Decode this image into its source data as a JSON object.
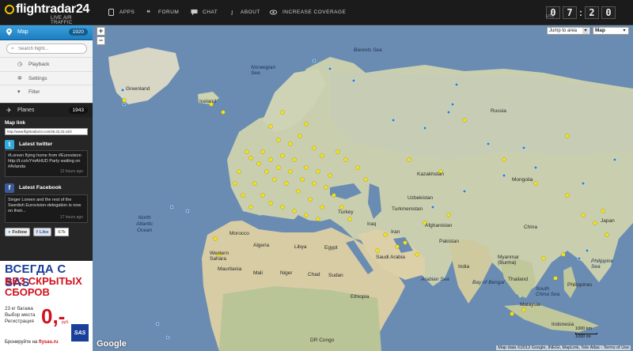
{
  "app": {
    "logo": "flightradar24",
    "tagline": "LIVE AIR TRAFFIC"
  },
  "nav": {
    "items": [
      {
        "label": "APPS",
        "icon": "apps-icon"
      },
      {
        "label": "FORUM",
        "icon": "forum-icon"
      },
      {
        "label": "CHAT",
        "icon": "chat-icon"
      },
      {
        "label": "ABOUT",
        "icon": "info-icon"
      },
      {
        "label": "INCREASE COVERAGE",
        "icon": "eye-icon"
      }
    ]
  },
  "clock": {
    "digits": [
      "0",
      "7",
      "2",
      "0"
    ],
    "separator": ":",
    "zone": "UTC"
  },
  "sidebar": {
    "map": {
      "label": "Map",
      "count": "1920"
    },
    "search": {
      "placeholder": "Search flight..."
    },
    "submenu": [
      {
        "label": "Playback",
        "icon": "clock-icon"
      },
      {
        "label": "Settings",
        "icon": "gear-icon"
      },
      {
        "label": "Filter",
        "icon": "filter-icon"
      }
    ],
    "planes": {
      "label": "Planes",
      "count": "1943"
    },
    "map_link": {
      "label": "Map link",
      "url": "http://www.flightradar24.com/48.32,23.44/3"
    },
    "twitter": {
      "title": "Latest twitter",
      "text": "#Loreen flying home from #Eurovision http://t.co/vYmAHUD Party waiting on #Arlanda",
      "ago": "12 hours ago"
    },
    "facebook": {
      "title": "Latest Facebook",
      "text": "Singer Loreen and the rest of the Swedish Eurovision-delegation is now on their...",
      "ago": "17 hours ago"
    },
    "buttons": {
      "follow": "Follow",
      "like": "Like",
      "like_count": "67k"
    }
  },
  "ad": {
    "line1": "ВСЕГДА С SAS",
    "line2": "БЕЗ СКРЫТЫХ",
    "line3": "СБОРОВ",
    "features": [
      "23 кг багажа",
      "Выбор места",
      "Регистрация"
    ],
    "price": "0,-",
    "currency": "руб.",
    "brand": "SAS",
    "booking": "Бронируйте на",
    "booking_site": "flysas.ru"
  },
  "map": {
    "controls": {
      "zoom_in": "+",
      "zoom_out": "−"
    },
    "jump_to": "Jump to area",
    "map_type": "Map",
    "google": "Google",
    "attribution": "Map data ©2012 Google, INEGI, MapLink, Tele Atlas - Terms of Use",
    "scale": {
      "top": "1000 km",
      "bottom": "1000 mi"
    },
    "labels": {
      "greenland": "Greenland",
      "iceland": "Iceland",
      "norwegian_sea": "Norwegian\nSea",
      "barents_sea": "Barents Sea",
      "russia": "Russia",
      "kazakhstan": "Kazakhstan",
      "mongolia": "Mongolia",
      "uzbekistan": "Uzbekistan",
      "turkmenistan": "Turkmenistan",
      "afghanistan": "Afghanistan",
      "pakistan": "Pakistan",
      "iran": "Iran",
      "iraq": "Iraq",
      "turkey": "Turkey",
      "egypt": "Egypt",
      "libya": "Libya",
      "algeria": "Algeria",
      "morocco": "Morocco",
      "western_sahara": "Western\nSahara",
      "mauritania": "Mauritania",
      "mali": "Mali",
      "niger": "Niger",
      "chad": "Chad",
      "sudan": "Sudan",
      "ethiopia": "Ethiopia",
      "saudi_arabia": "Saudi Arabia",
      "india": "India",
      "china": "China",
      "japan": "Japan",
      "thailand": "Thailand",
      "myanmar": "Myanmar\n(Burma)",
      "philippines": "Philippines",
      "indonesia": "Indonesia",
      "malaysia": "Malaysia",
      "dr_congo": "DR Congo",
      "north_atlantic": "North\nAtlantic\nOcean",
      "arabian_sea": "Arabian Sea",
      "bay_of_bengal": "Bay of Bengal",
      "south_china_sea": "South\nChina Sea",
      "philippine_sea": "Philippine\nSea"
    }
  }
}
